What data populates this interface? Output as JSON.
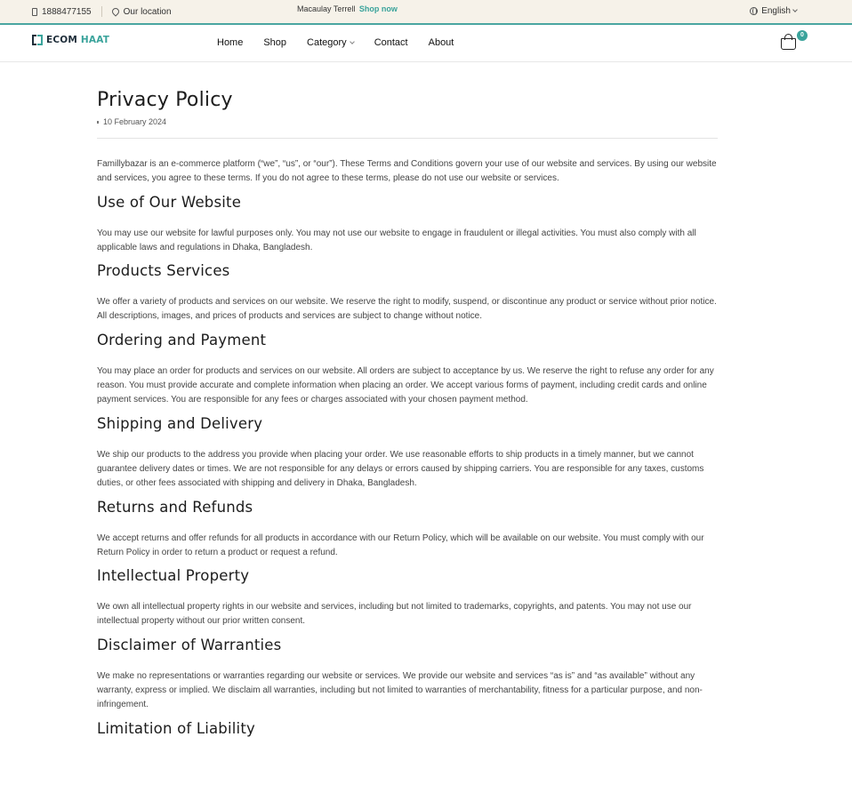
{
  "topbar": {
    "phone": "1888477155",
    "location": "Our location",
    "promo_name": "Macaulay Terrell",
    "promo_link": "Shop now",
    "language": "English"
  },
  "navbar": {
    "logo_left": "ECOM",
    "logo_right": "HAAT",
    "menu": [
      "Home",
      "Shop",
      "Category",
      "Contact",
      "About"
    ],
    "cart_count": "0"
  },
  "page": {
    "title": "Privacy Policy",
    "date": "10 February 2024",
    "intro": "Famillybazar is an e-commerce platform (“we”, “us”, or “our”). These Terms and Conditions govern your use of our website and services. By using our website and services, you agree to these terms. If you do not agree to these terms, please do not use our website or services.",
    "sections": [
      {
        "heading": "Use of Our Website",
        "text": "You may use our website for lawful purposes only. You may not use our website to engage in fraudulent or illegal activities. You must also comply with all applicable laws and regulations in Dhaka, Bangladesh."
      },
      {
        "heading": "Products Services",
        "text": "We offer a variety of products and services on our website. We reserve the right to modify, suspend, or discontinue any product or service without prior notice. All descriptions, images, and prices of products and services are subject to change without notice."
      },
      {
        "heading": "Ordering and Payment",
        "text": "You may place an order for products and services on our website. All orders are subject to acceptance by us. We reserve the right to refuse any order for any reason. You must provide accurate and complete information when placing an order. We accept various forms of payment, including credit cards and online payment services. You are responsible for any fees or charges associated with your chosen payment method."
      },
      {
        "heading": "Shipping and Delivery",
        "text": "We ship our products to the address you provide when placing your order. We use reasonable efforts to ship products in a timely manner, but we cannot guarantee delivery dates or times. We are not responsible for any delays or errors caused by shipping carriers. You are responsible for any taxes, customs duties, or other fees associated with shipping and delivery in Dhaka, Bangladesh."
      },
      {
        "heading": "Returns and Refunds",
        "text": "We accept returns and offer refunds for all products in accordance with our Return Policy, which will be available on our website. You must comply with our Return Policy in order to return a product or request a refund."
      },
      {
        "heading": "Intellectual Property",
        "text": "We own all intellectual property rights in our website and services, including but not limited to trademarks, copyrights, and patents. You may not use our intellectual property without our prior written consent."
      },
      {
        "heading": "Disclaimer of Warranties",
        "text": "We make no representations or warranties regarding our website or services. We provide our website and services “as is” and “as available” without any warranty, express or implied. We disclaim all warranties, including but not limited to warranties of merchantability, fitness for a particular purpose, and non-infringement."
      },
      {
        "heading": "Limitation of Liability",
        "text": ""
      }
    ]
  }
}
